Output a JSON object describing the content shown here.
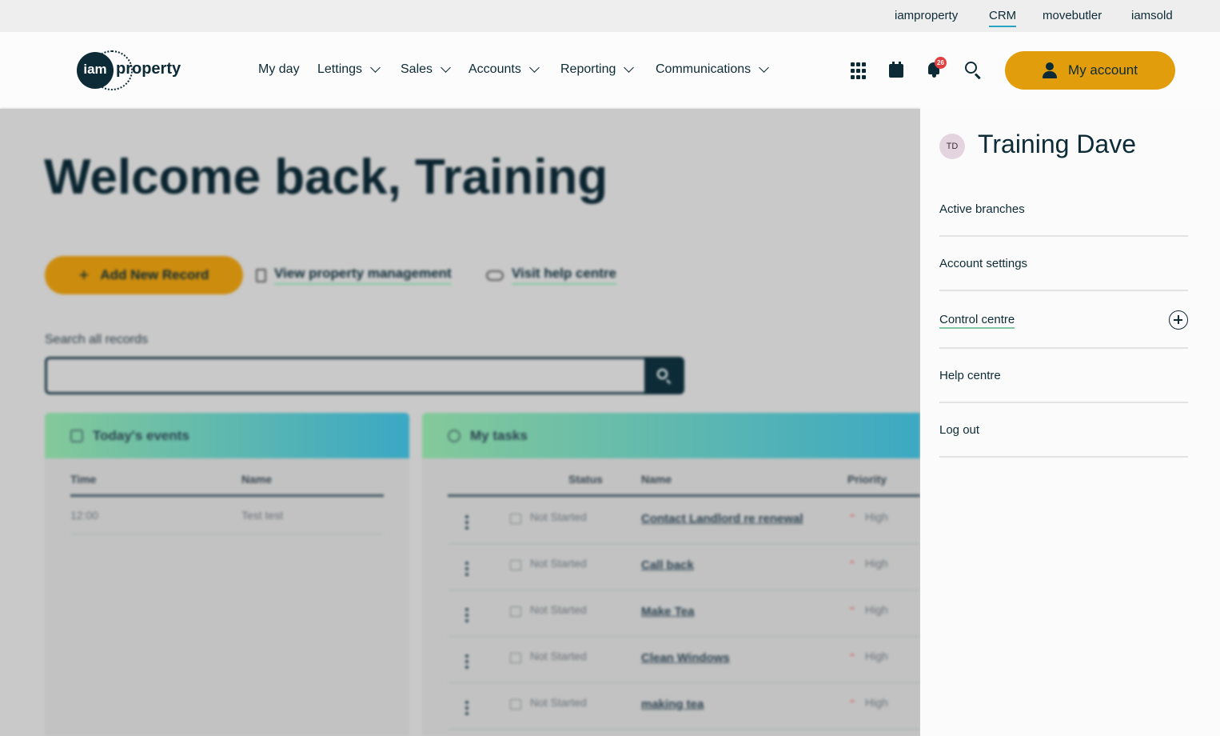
{
  "utility_nav": {
    "links": [
      "iamproperty",
      "CRM",
      "movebutler",
      "iamsold"
    ],
    "active": "CRM"
  },
  "header": {
    "logo": {
      "badge": "iam",
      "word": "property"
    },
    "nav": [
      "My day",
      "Lettings",
      "Sales",
      "Accounts",
      "Reporting",
      "Communications"
    ],
    "icons": [
      "apps-grid-icon",
      "calendar-icon",
      "bell-icon",
      "search-icon"
    ],
    "notification_count": "26",
    "account_button": "My account"
  },
  "dashboard": {
    "welcome": "Welcome back, Training",
    "add_button": "Add New Record",
    "view_link": "View property management",
    "help_link": "Visit help centre",
    "search_label": "Search all records",
    "events_panel": {
      "title": "Today's events",
      "columns": [
        "Time",
        "Name"
      ],
      "rows": [
        {
          "time": "12:00",
          "name": "Test test"
        }
      ]
    },
    "tasks_panel": {
      "title": "My tasks",
      "columns": [
        "Status",
        "Name",
        "Priority"
      ],
      "rows": [
        {
          "status": "Not Started",
          "name": "Contact Landlord re renewal",
          "priority": "High"
        },
        {
          "status": "Not Started",
          "name": "Call back",
          "priority": "High"
        },
        {
          "status": "Not Started",
          "name": "Make Tea",
          "priority": "High"
        },
        {
          "status": "Not Started",
          "name": "Clean Windows",
          "priority": "High"
        },
        {
          "status": "Not Started",
          "name": "making tea",
          "priority": "High"
        }
      ]
    }
  },
  "drawer": {
    "avatar_initials": "TD",
    "user_name": "Training Dave",
    "menu": [
      "Active branches",
      "Account settings",
      "Control centre",
      "Help centre",
      "Log out"
    ]
  },
  "colors": {
    "brand_navy": "#0d2b36",
    "accent_amber": "#e19d0b",
    "underline_green": "#7ec7a0",
    "active_link_blue": "#27a3c4",
    "notification_red": "#e04040"
  }
}
